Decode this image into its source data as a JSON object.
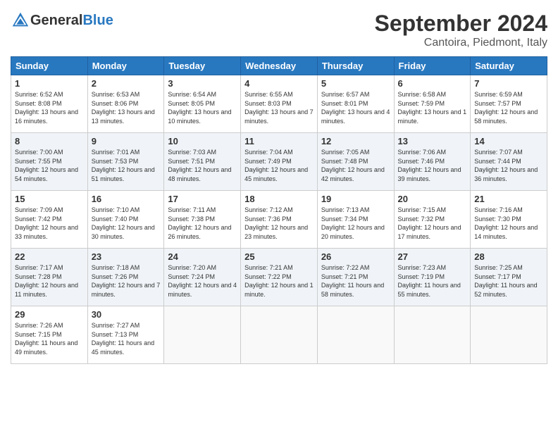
{
  "header": {
    "logo_general": "General",
    "logo_blue": "Blue",
    "month_title": "September 2024",
    "location": "Cantoira, Piedmont, Italy"
  },
  "days_of_week": [
    "Sunday",
    "Monday",
    "Tuesday",
    "Wednesday",
    "Thursday",
    "Friday",
    "Saturday"
  ],
  "weeks": [
    [
      {
        "day": "1",
        "sunrise": "6:52 AM",
        "sunset": "8:08 PM",
        "daylight": "13 hours and 16 minutes."
      },
      {
        "day": "2",
        "sunrise": "6:53 AM",
        "sunset": "8:06 PM",
        "daylight": "13 hours and 13 minutes."
      },
      {
        "day": "3",
        "sunrise": "6:54 AM",
        "sunset": "8:05 PM",
        "daylight": "13 hours and 10 minutes."
      },
      {
        "day": "4",
        "sunrise": "6:55 AM",
        "sunset": "8:03 PM",
        "daylight": "13 hours and 7 minutes."
      },
      {
        "day": "5",
        "sunrise": "6:57 AM",
        "sunset": "8:01 PM",
        "daylight": "13 hours and 4 minutes."
      },
      {
        "day": "6",
        "sunrise": "6:58 AM",
        "sunset": "7:59 PM",
        "daylight": "13 hours and 1 minute."
      },
      {
        "day": "7",
        "sunrise": "6:59 AM",
        "sunset": "7:57 PM",
        "daylight": "12 hours and 58 minutes."
      }
    ],
    [
      {
        "day": "8",
        "sunrise": "7:00 AM",
        "sunset": "7:55 PM",
        "daylight": "12 hours and 54 minutes."
      },
      {
        "day": "9",
        "sunrise": "7:01 AM",
        "sunset": "7:53 PM",
        "daylight": "12 hours and 51 minutes."
      },
      {
        "day": "10",
        "sunrise": "7:03 AM",
        "sunset": "7:51 PM",
        "daylight": "12 hours and 48 minutes."
      },
      {
        "day": "11",
        "sunrise": "7:04 AM",
        "sunset": "7:49 PM",
        "daylight": "12 hours and 45 minutes."
      },
      {
        "day": "12",
        "sunrise": "7:05 AM",
        "sunset": "7:48 PM",
        "daylight": "12 hours and 42 minutes."
      },
      {
        "day": "13",
        "sunrise": "7:06 AM",
        "sunset": "7:46 PM",
        "daylight": "12 hours and 39 minutes."
      },
      {
        "day": "14",
        "sunrise": "7:07 AM",
        "sunset": "7:44 PM",
        "daylight": "12 hours and 36 minutes."
      }
    ],
    [
      {
        "day": "15",
        "sunrise": "7:09 AM",
        "sunset": "7:42 PM",
        "daylight": "12 hours and 33 minutes."
      },
      {
        "day": "16",
        "sunrise": "7:10 AM",
        "sunset": "7:40 PM",
        "daylight": "12 hours and 30 minutes."
      },
      {
        "day": "17",
        "sunrise": "7:11 AM",
        "sunset": "7:38 PM",
        "daylight": "12 hours and 26 minutes."
      },
      {
        "day": "18",
        "sunrise": "7:12 AM",
        "sunset": "7:36 PM",
        "daylight": "12 hours and 23 minutes."
      },
      {
        "day": "19",
        "sunrise": "7:13 AM",
        "sunset": "7:34 PM",
        "daylight": "12 hours and 20 minutes."
      },
      {
        "day": "20",
        "sunrise": "7:15 AM",
        "sunset": "7:32 PM",
        "daylight": "12 hours and 17 minutes."
      },
      {
        "day": "21",
        "sunrise": "7:16 AM",
        "sunset": "7:30 PM",
        "daylight": "12 hours and 14 minutes."
      }
    ],
    [
      {
        "day": "22",
        "sunrise": "7:17 AM",
        "sunset": "7:28 PM",
        "daylight": "12 hours and 11 minutes."
      },
      {
        "day": "23",
        "sunrise": "7:18 AM",
        "sunset": "7:26 PM",
        "daylight": "12 hours and 7 minutes."
      },
      {
        "day": "24",
        "sunrise": "7:20 AM",
        "sunset": "7:24 PM",
        "daylight": "12 hours and 4 minutes."
      },
      {
        "day": "25",
        "sunrise": "7:21 AM",
        "sunset": "7:22 PM",
        "daylight": "12 hours and 1 minute."
      },
      {
        "day": "26",
        "sunrise": "7:22 AM",
        "sunset": "7:21 PM",
        "daylight": "11 hours and 58 minutes."
      },
      {
        "day": "27",
        "sunrise": "7:23 AM",
        "sunset": "7:19 PM",
        "daylight": "11 hours and 55 minutes."
      },
      {
        "day": "28",
        "sunrise": "7:25 AM",
        "sunset": "7:17 PM",
        "daylight": "11 hours and 52 minutes."
      }
    ],
    [
      {
        "day": "29",
        "sunrise": "7:26 AM",
        "sunset": "7:15 PM",
        "daylight": "11 hours and 49 minutes."
      },
      {
        "day": "30",
        "sunrise": "7:27 AM",
        "sunset": "7:13 PM",
        "daylight": "11 hours and 45 minutes."
      },
      null,
      null,
      null,
      null,
      null
    ]
  ]
}
